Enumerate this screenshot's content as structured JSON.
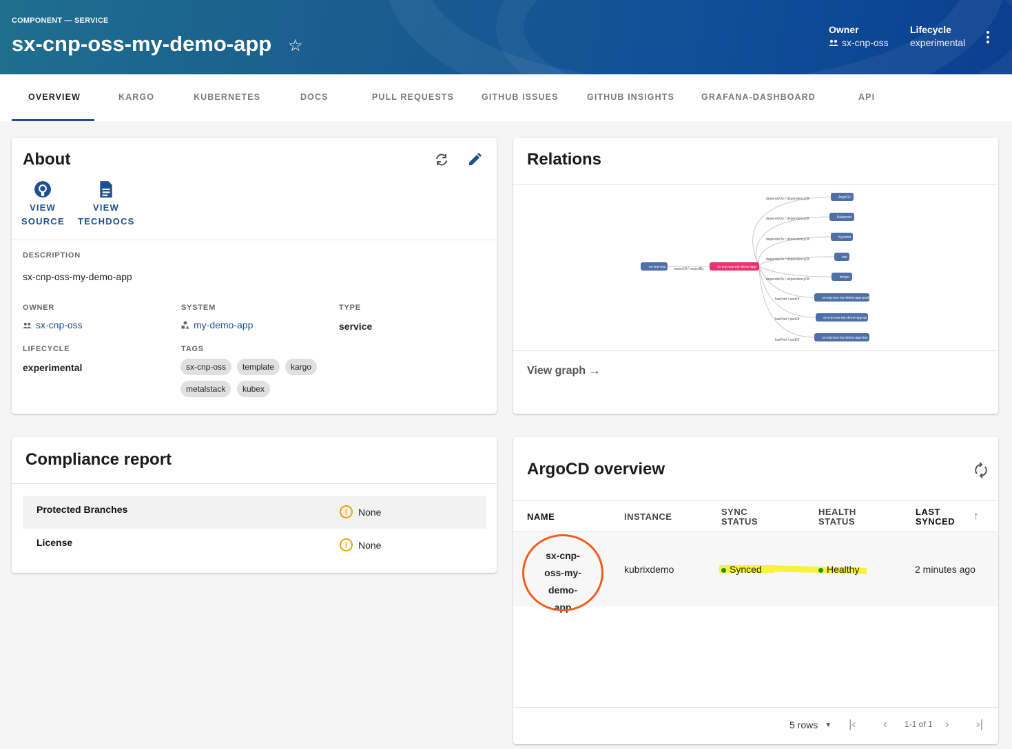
{
  "header": {
    "kind": "COMPONENT — SERVICE",
    "title": "sx-cnp-oss-my-demo-app",
    "owner_label": "Owner",
    "owner_value": "sx-cnp-oss",
    "lifecycle_label": "Lifecycle",
    "lifecycle_value": "experimental"
  },
  "tabs": [
    {
      "label": "OVERVIEW"
    },
    {
      "label": "KARGO"
    },
    {
      "label": "KUBERNETES"
    },
    {
      "label": "DOCS"
    },
    {
      "label": "PULL REQUESTS"
    },
    {
      "label": "GITHUB ISSUES"
    },
    {
      "label": "GITHUB INSIGHTS"
    },
    {
      "label": "GRAFANA-DASHBOARD"
    },
    {
      "label": "API"
    }
  ],
  "about": {
    "title": "About",
    "view_source_1": "VIEW",
    "view_source_2": "SOURCE",
    "view_techdocs_1": "VIEW",
    "view_techdocs_2": "TECHDOCS",
    "description_label": "DESCRIPTION",
    "description_value": "sx-cnp-oss-my-demo-app",
    "owner_label": "OWNER",
    "owner_value": "sx-cnp-oss",
    "system_label": "SYSTEM",
    "system_value": "my-demo-app",
    "type_label": "TYPE",
    "type_value": "service",
    "lifecycle_label": "LIFECYCLE",
    "lifecycle_value": "experimental",
    "tags_label": "TAGS",
    "tags": [
      "sx-cnp-oss",
      "template",
      "kargo",
      "metalstack",
      "kubex"
    ]
  },
  "relations": {
    "title": "Relations",
    "view_graph": "View graph",
    "root_left": "sx-cnp-oss",
    "center": "sx-cnp-oss-my-demo-app",
    "owner_edge": "ownerOf / ownedBy",
    "depends_edge": "dependsOn / dependencyOf",
    "haspart_edge": "hasPart / partOf",
    "deps": [
      "ArgoCD",
      "Kubecost",
      "Kyverno",
      "loki",
      "tempo"
    ],
    "parts": [
      "sx-cnp-oss-my-demo-app-prod",
      "sx-cnp-oss-my-demo-app-qs",
      "sx-cnp-oss-my-demo-app-test"
    ]
  },
  "compliance": {
    "title": "Compliance report",
    "rows": [
      {
        "name": "Protected Branches",
        "value": "None"
      },
      {
        "name": "License",
        "value": "None"
      }
    ]
  },
  "argocd": {
    "title": "ArgoCD overview",
    "headers": {
      "name": "NAME",
      "instance": "INSTANCE",
      "sync_1": "SYNC",
      "sync_2": "STATUS",
      "health_1": "HEALTH",
      "health_2": "STATUS",
      "last_1": "LAST",
      "last_2": "SYNCED"
    },
    "row": {
      "name_1": "sx-cnp-",
      "name_2": "oss-my-",
      "name_3": "demo-app",
      "instance": "kubrixdemo",
      "sync": "Synced",
      "health": "Healthy",
      "last_synced": "2 minutes ago"
    },
    "pager": {
      "rows": "5 rows",
      "range": "1-1 of 1"
    }
  },
  "colors": {
    "accent": "#1d4f91",
    "highlight": "#f7f23a",
    "annotation": "#f25c1b",
    "status_green": "#1a8f2a",
    "warning": "#f0a000",
    "node_blue": "#4e6fa8",
    "node_pink": "#e8336e"
  }
}
